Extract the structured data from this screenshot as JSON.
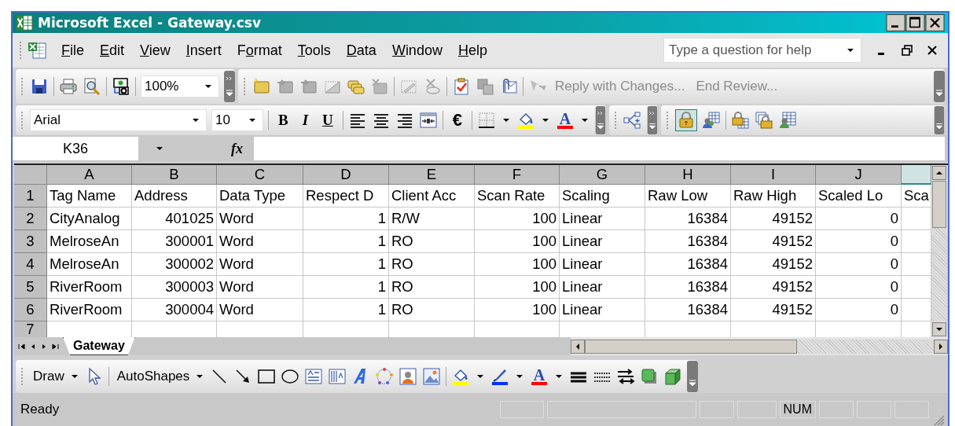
{
  "window": {
    "title": "Microsoft Excel - Gateway.csv"
  },
  "menu": [
    {
      "key": "F",
      "rest": "ile"
    },
    {
      "key": "E",
      "rest": "dit"
    },
    {
      "key": "V",
      "rest": "iew"
    },
    {
      "key": "I",
      "rest": "nsert"
    },
    {
      "before": "F",
      "key": "o",
      "rest": "rmat"
    },
    {
      "key": "T",
      "rest": "ools"
    },
    {
      "key": "D",
      "rest": "ata"
    },
    {
      "key": "W",
      "rest": "indow"
    },
    {
      "key": "H",
      "rest": "elp"
    }
  ],
  "help_search": {
    "placeholder": "Type a question for help"
  },
  "standard_toolbar": {
    "zoom": "100%"
  },
  "reviewing_toolbar": {
    "actions": [
      {
        "label": "Reply with Changes...",
        "disabled": true
      },
      {
        "label": "End Review...",
        "disabled": true
      }
    ]
  },
  "formatting_toolbar": {
    "font": "Arial",
    "size": "10",
    "bold": "B",
    "italic": "I",
    "underline": "U",
    "currency": "€",
    "font_color_letter": "A"
  },
  "formula_bar": {
    "name_box": "K36",
    "function_label": "fx"
  },
  "sheet": {
    "columns": [
      {
        "letter": "A",
        "kind": "text",
        "selected": false
      },
      {
        "letter": "B",
        "kind": "number",
        "selected": false
      },
      {
        "letter": "C",
        "kind": "text",
        "selected": false
      },
      {
        "letter": "D",
        "kind": "number",
        "selected": false
      },
      {
        "letter": "E",
        "kind": "text",
        "selected": false
      },
      {
        "letter": "F",
        "kind": "number",
        "selected": false
      },
      {
        "letter": "G",
        "kind": "text",
        "selected": false
      },
      {
        "letter": "H",
        "kind": "number",
        "selected": false
      },
      {
        "letter": "I",
        "kind": "number",
        "selected": false
      },
      {
        "letter": "J",
        "kind": "number",
        "selected": false
      },
      {
        "selected": true
      }
    ],
    "rows": [
      {
        "number": "1",
        "kind": "header",
        "cells": [
          "Tag Name",
          "Address",
          "Data Type",
          "Respect D",
          "Client Acc",
          "Scan Rate",
          "Scaling",
          "Raw Low",
          "Raw High",
          "Scaled Lo",
          "Sca"
        ]
      },
      {
        "number": "2",
        "kind": "data",
        "cells": [
          "CityAnalog",
          "401025",
          "Word",
          "1",
          "R/W",
          "100",
          "Linear",
          "16384",
          "49152",
          "0"
        ]
      },
      {
        "number": "3",
        "kind": "data",
        "cells": [
          "MelroseAn",
          "300001",
          "Word",
          "1",
          "RO",
          "100",
          "Linear",
          "16384",
          "49152",
          "0"
        ]
      },
      {
        "number": "4",
        "kind": "data",
        "cells": [
          "MelroseAn",
          "300002",
          "Word",
          "1",
          "RO",
          "100",
          "Linear",
          "16384",
          "49152",
          "0"
        ]
      },
      {
        "number": "5",
        "kind": "data",
        "cells": [
          "RiverRoom",
          "300003",
          "Word",
          "1",
          "RO",
          "100",
          "Linear",
          "16384",
          "49152",
          "0"
        ]
      },
      {
        "number": "6",
        "kind": "data",
        "cells": [
          "RiverRoom",
          "300004",
          "Word",
          "1",
          "RO",
          "100",
          "Linear",
          "16384",
          "49152",
          "0"
        ]
      },
      {
        "number": "7"
      }
    ]
  },
  "sheet_tabs": [
    {
      "label": "Gateway",
      "selected": true
    }
  ],
  "drawing_toolbar": {
    "draw": "Draw",
    "autoshapes": "AutoShapes",
    "font_color_letter": "A"
  },
  "status_bar": {
    "status": "Ready",
    "indicators": [
      "NUM"
    ]
  }
}
